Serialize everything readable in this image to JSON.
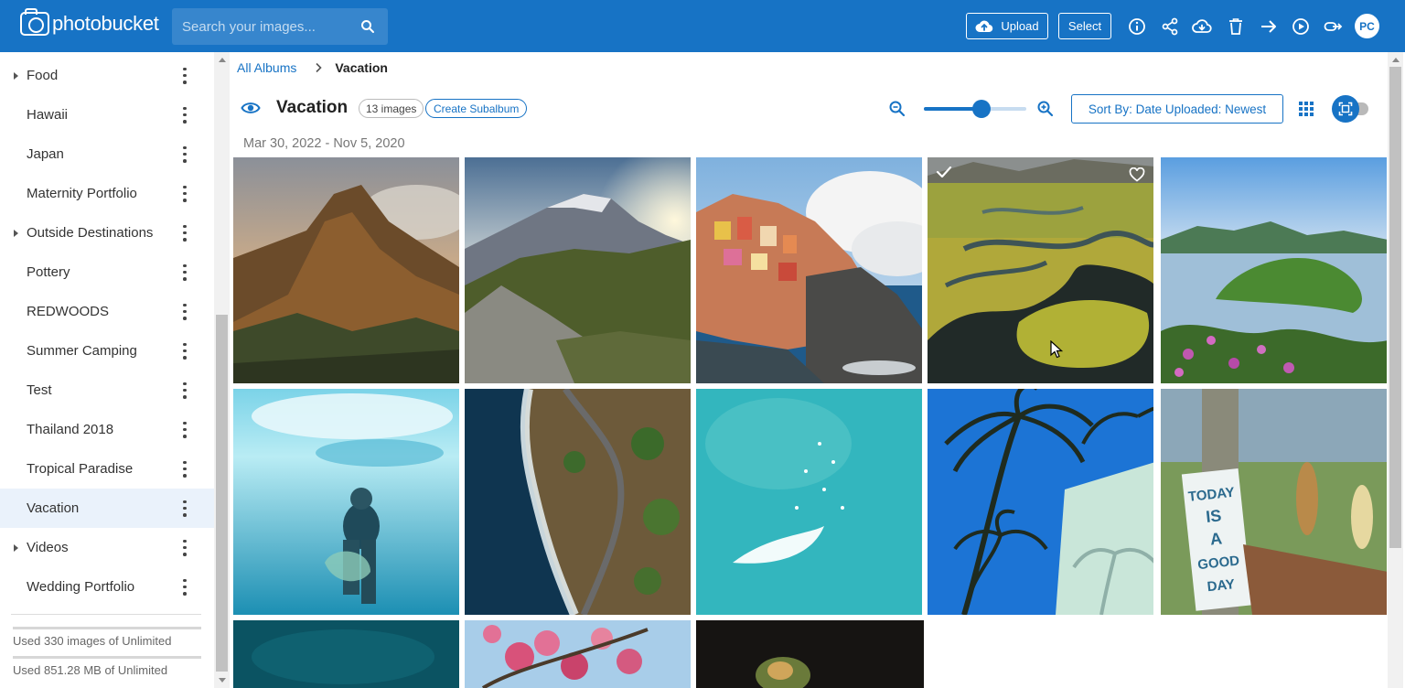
{
  "app": {
    "brand": "photobucket"
  },
  "topbar": {
    "search_placeholder": "Search your images...",
    "upload_label": "Upload",
    "select_label": "Select",
    "avatar_initials": "PC"
  },
  "sidebar": {
    "albums": [
      {
        "label": "Food",
        "expandable": true
      },
      {
        "label": "Hawaii",
        "expandable": false
      },
      {
        "label": "Japan",
        "expandable": false
      },
      {
        "label": "Maternity Portfolio",
        "expandable": false
      },
      {
        "label": "Outside Destinations",
        "expandable": true
      },
      {
        "label": "Pottery",
        "expandable": false
      },
      {
        "label": "REDWOODS",
        "expandable": false
      },
      {
        "label": "Summer Camping",
        "expandable": false
      },
      {
        "label": "Test",
        "expandable": false
      },
      {
        "label": "Thailand 2018",
        "expandable": false
      },
      {
        "label": "Tropical Paradise",
        "expandable": false
      },
      {
        "label": "Vacation",
        "expandable": false,
        "active": true
      },
      {
        "label": "Videos",
        "expandable": true
      },
      {
        "label": "Wedding Portfolio",
        "expandable": false
      }
    ],
    "usage_images": "Used 330 images of Unlimited",
    "usage_storage": "Used 851.28 MB of Unlimited"
  },
  "breadcrumb": {
    "root": "All Albums",
    "current": "Vacation"
  },
  "album": {
    "title": "Vacation",
    "count": "13 images",
    "create_subalbum": "Create Subalbum",
    "date_range": "Mar 30, 2022 - Nov 5, 2020",
    "zoom_level": 0.56,
    "sort_label": "Sort By: Date Uploaded: Newest"
  },
  "colors": {
    "brand": "#1773c5",
    "active_row": "#eaf2fb"
  },
  "photos": [
    {
      "name": "photo-kalalau-cliffs",
      "selected": false
    },
    {
      "name": "photo-mountain-sunburst",
      "selected": false
    },
    {
      "name": "photo-cinque-terre",
      "selected": false
    },
    {
      "name": "photo-green-river-wetland",
      "selected": true
    },
    {
      "name": "photo-lake-peninsula",
      "selected": false
    },
    {
      "name": "photo-underwater-diver",
      "selected": false
    },
    {
      "name": "photo-coastal-road-aerial",
      "selected": false
    },
    {
      "name": "photo-turquoise-sea-aerial",
      "selected": false
    },
    {
      "name": "photo-palm-trees-blue-sky",
      "selected": false
    },
    {
      "name": "photo-today-is-a-good-day-sign",
      "selected": false,
      "sign_text": "TODAY IS A GOOD DAY"
    },
    {
      "name": "photo-dark-teal-water",
      "selected": false
    },
    {
      "name": "photo-pink-blossoms",
      "selected": false
    },
    {
      "name": "photo-plated-food",
      "selected": false
    }
  ]
}
